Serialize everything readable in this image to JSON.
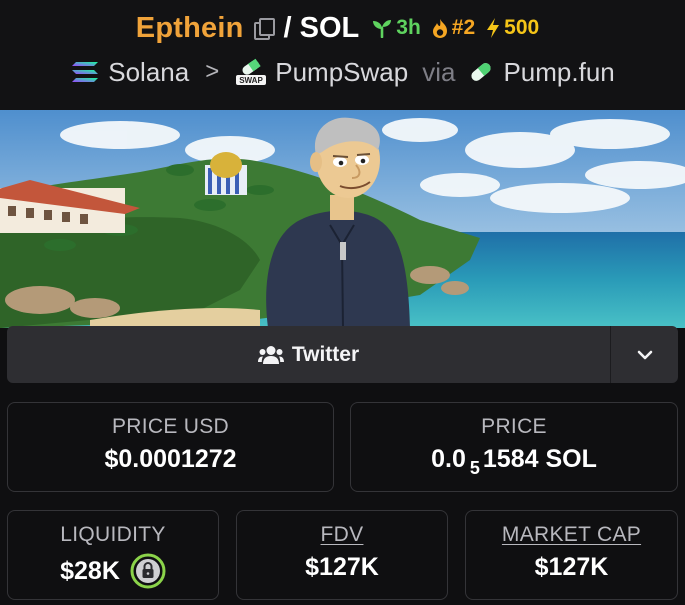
{
  "header": {
    "token_name": "Epthein",
    "pair": "/ SOL",
    "age": "3h",
    "rank": "#2",
    "boosts": "500"
  },
  "route": {
    "chain": "Solana",
    "separator": ">",
    "dex": "PumpSwap",
    "dex_badge": "SWAP",
    "via": "via",
    "launchpad": "Pump.fun"
  },
  "social": {
    "twitter_label": "Twitter"
  },
  "stats": {
    "price_usd_label": "PRICE USD",
    "price_usd_value": "$0.0001272",
    "price_label": "PRICE",
    "price_prefix": "0.0",
    "price_zeros": "5",
    "price_rest": "1584 SOL",
    "liquidity_label": "LIQUIDITY",
    "liquidity_value": "$28K",
    "fdv_label": "FDV",
    "fdv_value": "$127K",
    "mcap_label": "MARKET CAP",
    "mcap_value": "$127K"
  },
  "icons": {
    "copy": "copy-icon",
    "age": "seedling-icon",
    "rank": "flame-icon",
    "boost": "lightning-icon",
    "chain": "solana-icon",
    "dex": "pumpswap-icon",
    "launchpad": "pill-icon",
    "twitter": "users-icon",
    "toggle": "chevron-down-icon",
    "liquidity_lock": "lock-icon"
  },
  "colors": {
    "token_name": "#f0a33a",
    "age_badge": "#5fd35f",
    "rank_badge": "#f5a623",
    "boost_badge": "#f5c518",
    "lock_badge": "#8bd34a"
  }
}
